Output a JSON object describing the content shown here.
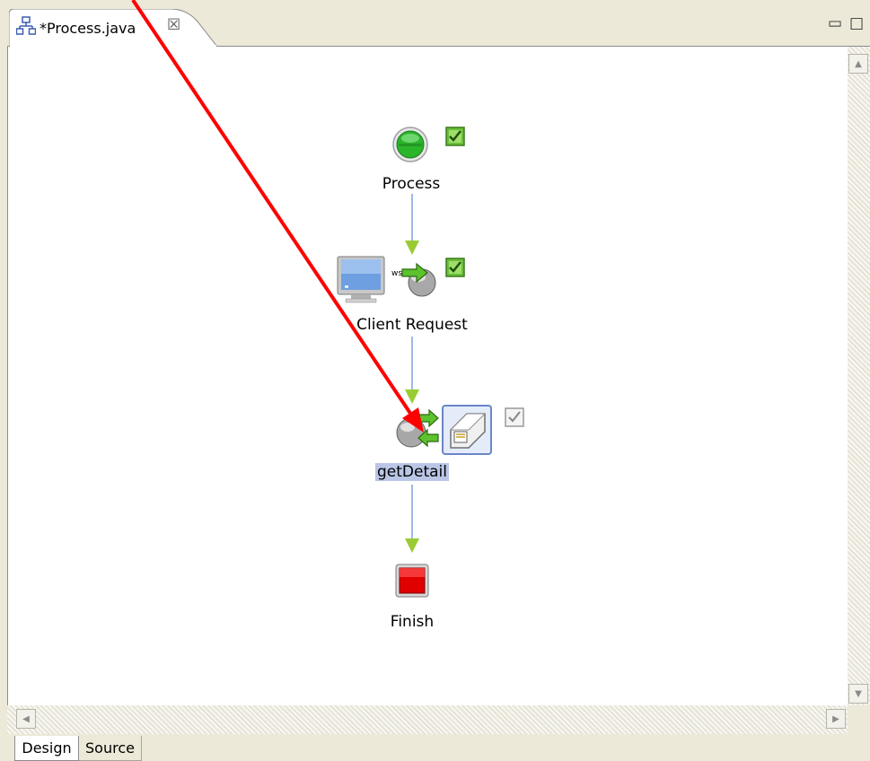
{
  "editor": {
    "tab_title": "*Process.java",
    "tab_icon": "process-diagram-icon",
    "close_glyph": "☒",
    "minimize_glyph": "▭",
    "maximize_glyph": "□"
  },
  "diagram": {
    "nodes": [
      {
        "id": "process",
        "label": "Process",
        "icon": "start-node-icon",
        "validated": true
      },
      {
        "id": "client-request",
        "label": "Client Request",
        "icon": "client-request-icon",
        "validated": true
      },
      {
        "id": "getdetail",
        "label": "getDetail",
        "icon": "service-invoke-icon",
        "validated": false,
        "selected": true
      },
      {
        "id": "finish",
        "label": "Finish",
        "icon": "finish-node-icon"
      }
    ],
    "connector_color": "#7fa0e0",
    "arrowhead_color": "#99cc33"
  },
  "annotation": {
    "arrow_color": "#ff0000"
  },
  "bottom_tabs": [
    {
      "label": "Design",
      "active": true
    },
    {
      "label": "Source",
      "active": false
    }
  ]
}
